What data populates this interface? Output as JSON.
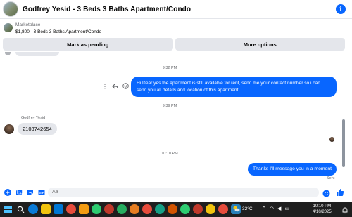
{
  "header": {
    "title": "Godfrey Yesid - 3 Beds 3 Baths Apartment/Condo",
    "info_icon": "info-icon"
  },
  "listing": {
    "kicker": "Marketplace",
    "summary": "$1,800 - 3 Beds 3 Baths Apartment/Condo"
  },
  "actions": {
    "mark_pending": "Mark as pending",
    "more_options": "More options"
  },
  "chat": {
    "timestamps": [
      "9:32 PM",
      "9:39 PM",
      "10:10 PM"
    ],
    "messages": [
      {
        "direction": "outgoing",
        "text": "Hi Dear yes the apartment  is still available for rent, send me your contact number so i can send you all details and location of this apartment"
      },
      {
        "direction": "incoming",
        "sender": "Godfrey Yesid",
        "text": "2103742654"
      },
      {
        "direction": "outgoing",
        "text": "Thanks I'll message you in a moment"
      }
    ],
    "sent_status": "Sent"
  },
  "composer": {
    "placeholder": "Aa",
    "icons": [
      "plus-icon",
      "photo-icon",
      "sticker-icon",
      "gif-icon",
      "emoji-icon",
      "like-icon"
    ]
  },
  "taskbar": {
    "weather_temp": "32°C",
    "time": "10:10 PM",
    "date": "4/10/2025"
  },
  "colors": {
    "accent": "#0866ff",
    "bubble_in": "#e4e6eb",
    "taskbar": "#1f1f1f"
  }
}
